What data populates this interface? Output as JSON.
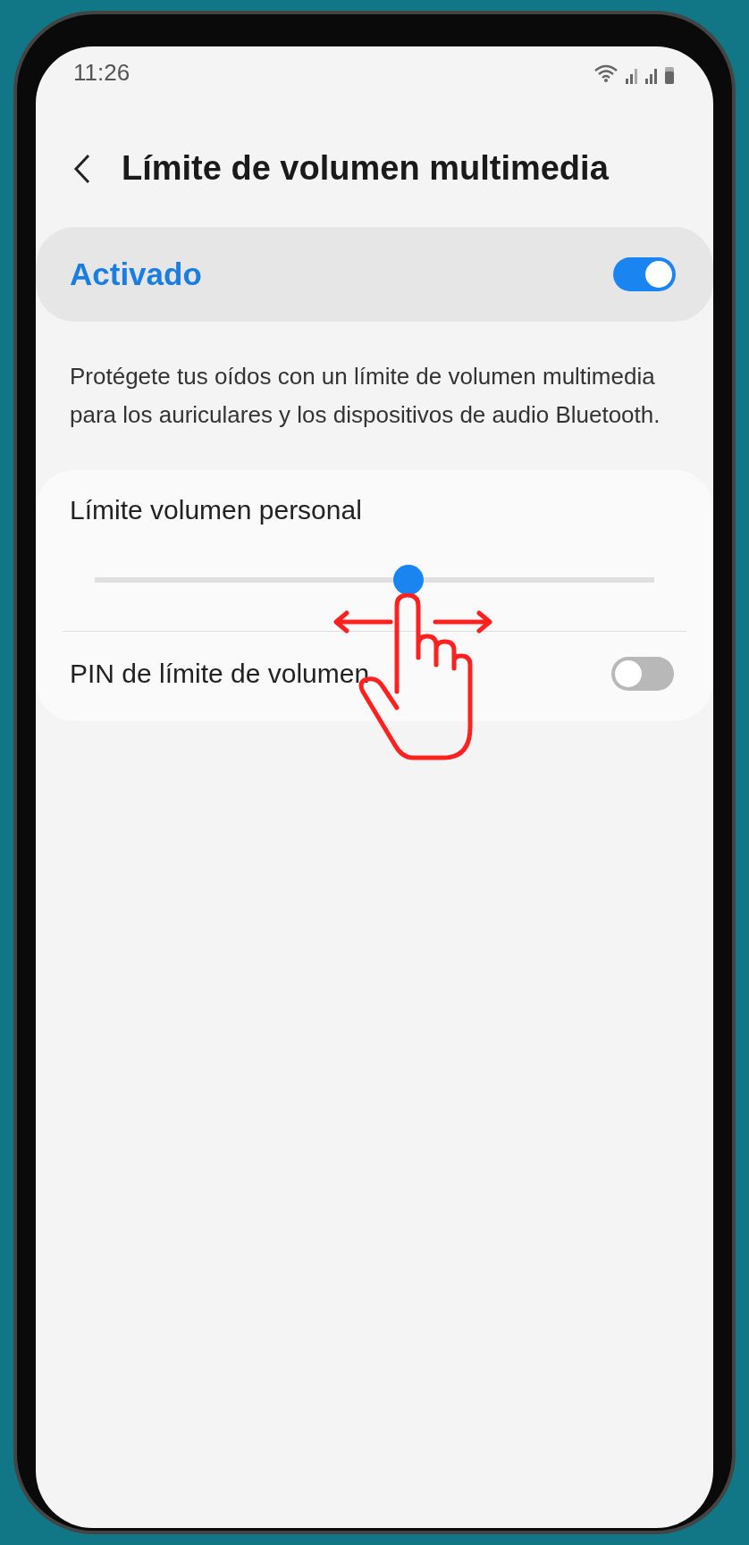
{
  "status_bar": {
    "time": "11:26"
  },
  "header": {
    "title": "Límite de volumen multimedia"
  },
  "main_switch": {
    "label": "Activado",
    "on": true
  },
  "description": "Protégete tus oídos con un límite de volumen multimedia para los auriculares y los dispositivos de audio Bluetooth.",
  "settings": [
    {
      "kind": "slider",
      "label": "Límite volumen personal",
      "level": 0.56
    },
    {
      "kind": "switch",
      "label": "PIN de límite de volumen",
      "on": false
    }
  ]
}
